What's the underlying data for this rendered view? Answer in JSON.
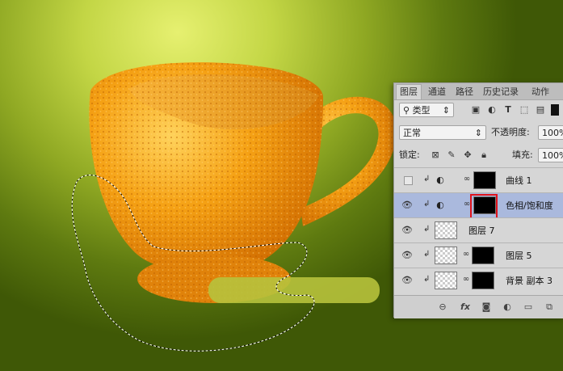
{
  "panel": {
    "tabs": [
      "图层",
      "通道",
      "路径",
      "历史记录",
      "动作"
    ],
    "filter_kind": "类型",
    "filter_icons": [
      "image-filter-icon",
      "adjustment-filter-icon",
      "type-filter-icon",
      "shape-filter-icon",
      "smart-object-filter-icon"
    ],
    "blend_mode": "正常",
    "opacity_label": "不透明度:",
    "opacity_value": "100%",
    "lock_label": "锁定:",
    "fill_label": "填充:",
    "fill_value": "100%",
    "layers": [
      {
        "name": "曲线 1",
        "visible": false,
        "type": "curves-adjustment",
        "selected": false
      },
      {
        "name": "色相/饱和度",
        "visible": true,
        "type": "hue-saturation-adjustment",
        "selected": true
      },
      {
        "name": "图层 7",
        "visible": true,
        "type": "pixel",
        "selected": false
      },
      {
        "name": "图层 5",
        "visible": true,
        "type": "pixel-with-mask",
        "selected": false
      },
      {
        "name": "背景 副本 3",
        "visible": true,
        "type": "pixel-with-mask",
        "selected": false
      }
    ],
    "footer_icons": [
      "link-icon",
      "fx-icon",
      "add-mask-icon",
      "new-adjustment-icon",
      "new-group-icon",
      "new-layer-icon"
    ]
  },
  "colors": {
    "highlight_box": "#e0141c",
    "selected_layer": "#aab9dd",
    "cup_orange": "#f29a10"
  },
  "fx_label": "fx"
}
